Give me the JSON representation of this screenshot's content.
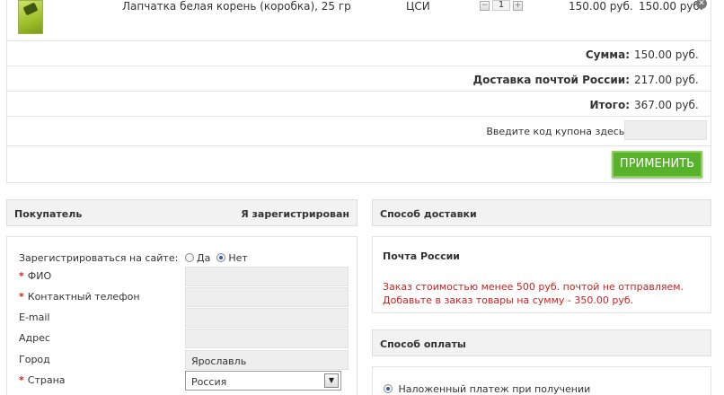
{
  "cart": {
    "product": {
      "name": "Лапчатка белая корень (коробка), 25 гр",
      "manufacturer": "ЦСИ",
      "quantity": "1",
      "price": "150.00 руб.",
      "total": "150.00 руб."
    },
    "summary": [
      {
        "label": "Сумма:",
        "value": "150.00 руб."
      },
      {
        "label": "Доставка почтой России:",
        "value": "217.00 руб."
      },
      {
        "label": "Итого:",
        "value": "367.00 руб."
      }
    ],
    "coupon_label": "Введите код купона здесь:",
    "coupon_value": "",
    "apply_label": "ПРИМЕНИТЬ"
  },
  "buyer": {
    "title": "Покупатель",
    "registered_link": "Я зарегистрирован",
    "register_label": "Зарегистрироваться на сайте:",
    "yes": "Да",
    "no": "Нет",
    "fields": [
      {
        "label": "ФИО",
        "required": true,
        "value": ""
      },
      {
        "label": "Контактный телефон",
        "required": true,
        "value": ""
      },
      {
        "label": "E-mail",
        "required": false,
        "value": ""
      },
      {
        "label": "Адрес",
        "required": false,
        "value": ""
      },
      {
        "label": "Город",
        "required": false,
        "value": "Ярославль"
      }
    ],
    "country_label": "Страна",
    "country_value": "Россия",
    "required_mark": "*"
  },
  "shipping": {
    "title": "Способ доставки",
    "method": "Почта России",
    "warning_line1": "Заказ стоимостью менее 500 руб. почтой не отправляем.",
    "warning_line2": "Добавьте в заказ товары на сумму - 350.00 руб."
  },
  "payment": {
    "title": "Способ оплаты",
    "option": "Наложенный платеж при получении"
  },
  "icons": {
    "minus": "−",
    "plus": "+",
    "remove": "✕",
    "dropdown": "▼"
  }
}
